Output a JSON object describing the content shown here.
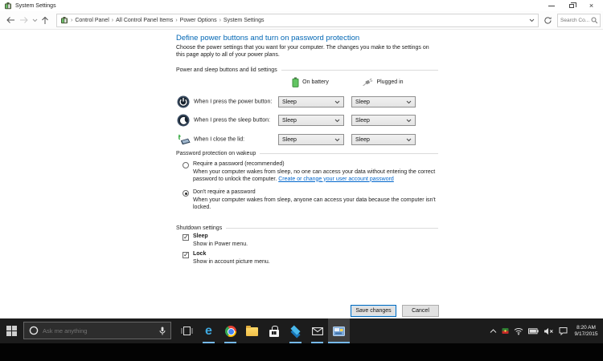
{
  "colors": {
    "accent_heading": "#0066b4",
    "link": "#0066cc",
    "taskbar_bg": "#1c1c1c",
    "taskbar_underline": "#76b9ed",
    "save_button_border": "#0067b8"
  },
  "window": {
    "title": "System Settings",
    "close_glyph": "×"
  },
  "navbar": {
    "back_glyph": "←",
    "forward_glyph": "→",
    "up_glyph": "↑",
    "breadcrumb": {
      "separator": "›",
      "items": [
        "Control Panel",
        "All Control Panel Items",
        "Power Options",
        "System Settings"
      ]
    },
    "search_placeholder": "Search Co..."
  },
  "page": {
    "heading": "Define power buttons and turn on password protection",
    "intro": "Choose the power settings that you want for your computer. The changes you make to the settings on this page apply to all of your power plans."
  },
  "power": {
    "title": "Power and sleep buttons and lid settings",
    "columns": [
      "On battery",
      "Plugged in"
    ],
    "rows": [
      {
        "label": "When I press the power button:",
        "on_battery": "Sleep",
        "plugged_in": "Sleep"
      },
      {
        "label": "When I press the sleep button:",
        "on_battery": "Sleep",
        "plugged_in": "Sleep"
      },
      {
        "label": "When I close the lid:",
        "on_battery": "Sleep",
        "plugged_in": "Sleep"
      }
    ]
  },
  "password": {
    "title": "Password protection on wakeup",
    "require": {
      "label": "Require a password (recommended)",
      "selected": false,
      "description": "When your computer wakes from sleep, no one can access your data without entering the correct password to unlock the computer. ",
      "link": "Create or change your user account password"
    },
    "dont_require": {
      "label": "Don't require a password",
      "selected": true,
      "description": "When your computer wakes from sleep, anyone can access your data because the computer isn't locked."
    }
  },
  "shutdown": {
    "title": "Shutdown settings",
    "sleep": {
      "label": "Sleep",
      "checked": true,
      "description": "Show in Power menu."
    },
    "lock": {
      "label": "Lock",
      "checked": true,
      "description": "Show in account picture menu."
    }
  },
  "actions": {
    "save": "Save changes",
    "cancel": "Cancel"
  },
  "taskbar": {
    "search_placeholder": "Ask me anything",
    "edge_glyph": "e",
    "apps": [
      "edge",
      "chrome",
      "file-explorer",
      "store",
      "bluestacks",
      "mail",
      "system-settings"
    ],
    "clock": {
      "time": "8:20 AM",
      "date": "9/17/2015"
    }
  }
}
